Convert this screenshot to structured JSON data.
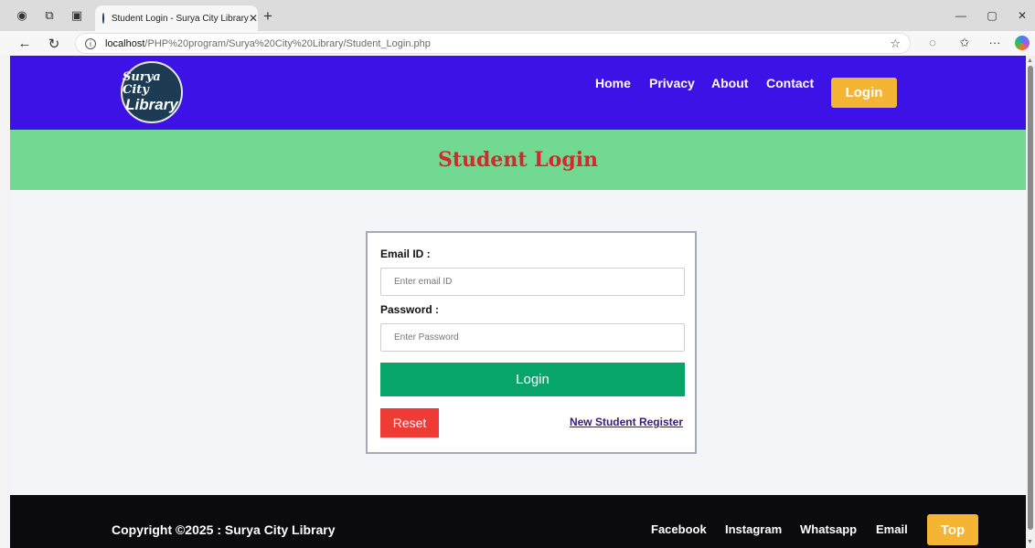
{
  "browser": {
    "tab_title": "Student Login - Surya City Library",
    "url_host": "localhost",
    "url_path": "/PHP%20program/Surya%20City%20Library/Student_Login.php"
  },
  "header": {
    "logo_line1": "Surya City",
    "logo_line2": "Library",
    "nav": [
      "Home",
      "Privacy",
      "About",
      "Contact"
    ],
    "login_label": "Login"
  },
  "banner": {
    "title": "Student Login"
  },
  "form": {
    "email_label": "Email ID :",
    "email_placeholder": "Enter email ID",
    "password_label": "Password :",
    "password_placeholder": "Enter Password",
    "login_button": "Login",
    "reset_button": "Reset",
    "register_link": "New Student Register"
  },
  "footer": {
    "copyright": "Copyright ©2025 : Surya City Library",
    "links": [
      "Facebook",
      "Instagram",
      "Whatsapp",
      "Email"
    ],
    "top_button": "Top"
  },
  "colors": {
    "header_bg": "#3d12e6",
    "banner_bg": "#72d992",
    "banner_text": "#d8262d",
    "accent_button": "#f5b534",
    "login_button": "#07a56a",
    "reset_button": "#ef3b36",
    "footer_bg": "#0b0b0f"
  }
}
